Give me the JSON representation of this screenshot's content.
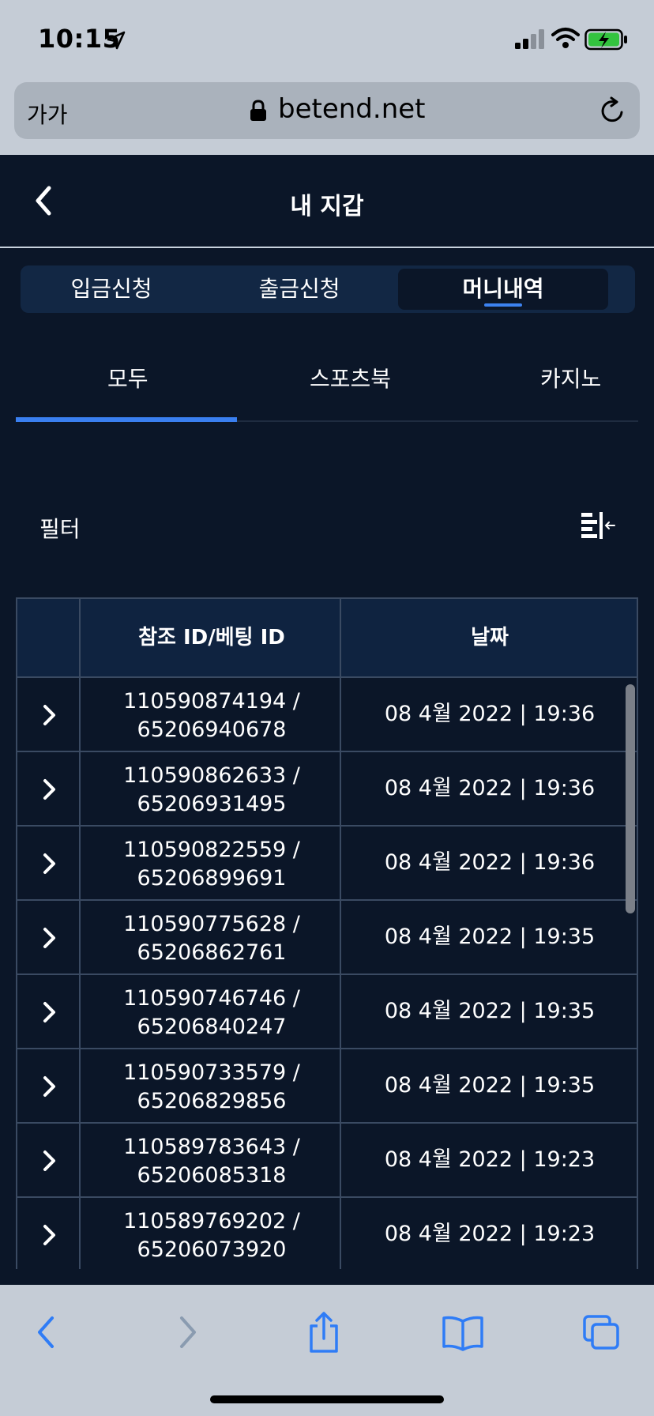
{
  "status_bar": {
    "time": "10:15",
    "icons": [
      "location-arrow-icon",
      "cellular-signal-icon",
      "wifi-icon",
      "battery-charging-icon"
    ]
  },
  "browser": {
    "aa_label": "가가",
    "url": "betend.net",
    "icons": [
      "lock-icon",
      "reload-icon"
    ]
  },
  "header": {
    "title": "내 지갑",
    "back_icon": "chevron-left-icon"
  },
  "tabs": [
    {
      "label": "입금신청",
      "active": false
    },
    {
      "label": "출금신청",
      "active": false
    },
    {
      "label": "머니내역",
      "active": true
    }
  ],
  "subtabs": [
    {
      "label": "모두",
      "active": true
    },
    {
      "label": "스포츠북",
      "active": false
    },
    {
      "label": "카지노",
      "active": false
    }
  ],
  "filter": {
    "label": "필터",
    "icon": "filter-collapse-icon"
  },
  "table": {
    "columns": [
      "",
      "참조 ID/베팅 ID",
      "날짜"
    ],
    "rows": [
      {
        "ref_line1": "110590874194 /",
        "ref_line2": "65206940678",
        "date": "08 4월 2022 | 19:36"
      },
      {
        "ref_line1": "110590862633 /",
        "ref_line2": "65206931495",
        "date": "08 4월 2022 | 19:36"
      },
      {
        "ref_line1": "110590822559 /",
        "ref_line2": "65206899691",
        "date": "08 4월 2022 | 19:36"
      },
      {
        "ref_line1": "110590775628 /",
        "ref_line2": "65206862761",
        "date": "08 4월 2022 | 19:35"
      },
      {
        "ref_line1": "110590746746 /",
        "ref_line2": "65206840247",
        "date": "08 4월 2022 | 19:35"
      },
      {
        "ref_line1": "110590733579 /",
        "ref_line2": "65206829856",
        "date": "08 4월 2022 | 19:35"
      },
      {
        "ref_line1": "110589783643 /",
        "ref_line2": "65206085318",
        "date": "08 4월 2022 | 19:23"
      },
      {
        "ref_line1": "110589769202 /",
        "ref_line2": "65206073920",
        "date": "08 4월 2022 | 19:23"
      }
    ]
  },
  "toolbar": {
    "icons": [
      "back-arrow-icon",
      "forward-arrow-icon",
      "share-icon",
      "bookmarks-icon",
      "tabs-icon"
    ]
  },
  "colors": {
    "background": "#0b1628",
    "accent": "#3a7ff0",
    "browser_chrome": "#c5ccd6",
    "toolbar_icon": "#2f7cf6"
  }
}
